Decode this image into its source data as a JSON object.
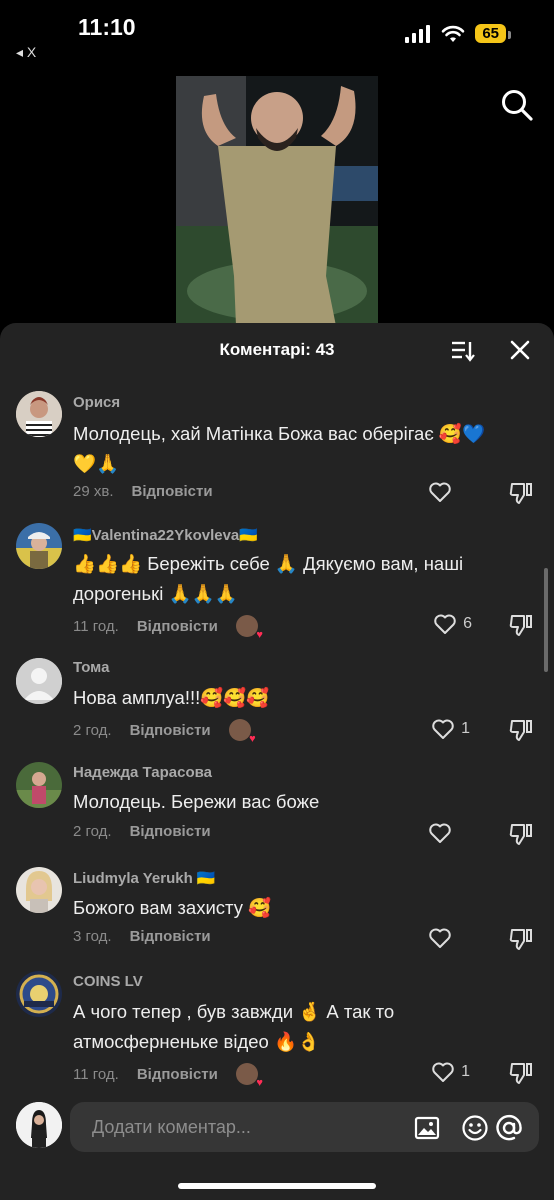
{
  "status": {
    "time": "11:10",
    "back": "◂ X",
    "battery": "65"
  },
  "comments_header": {
    "title": "Коментарі: 43"
  },
  "comments": [
    {
      "name": "Орися",
      "lines": [
        "Молодець, хай Матінка Божа вас оберігає 🥰💙",
        "💛🙏"
      ],
      "time": "29 хв.",
      "reply": "Відповісти",
      "likes": ""
    },
    {
      "name": "🇺🇦Valentina22Ykovleva🇺🇦",
      "lines": [
        "👍👍👍 Бережіть себе 🙏 Дякуємо вам, наші",
        "дорогенькі 🙏🙏🙏"
      ],
      "time": "11 год.",
      "reply": "Відповісти",
      "likes": "6"
    },
    {
      "name": "Тома",
      "lines": [
        "Нова амплуа!!!🥰🥰🥰"
      ],
      "time": "2 год.",
      "reply": "Відповісти",
      "likes": "1"
    },
    {
      "name": "Надежда Тарасова",
      "lines": [
        "Молодець. Бережи вас боже"
      ],
      "time": "2 год.",
      "reply": "Відповісти",
      "likes": ""
    },
    {
      "name": "Liudmyla Yerukh 🇺🇦",
      "lines": [
        "Божого вам захисту 🥰"
      ],
      "time": "3 год.",
      "reply": "Відповісти",
      "likes": ""
    },
    {
      "name": "COINS LV",
      "lines": [
        "А чого тепер , був завжди 🤞 А так то",
        "атмосферненьке відео 🔥👌"
      ],
      "time": "11 год.",
      "reply": "Відповісти",
      "likes": "1"
    }
  ],
  "input": {
    "placeholder": "Додати коментар..."
  },
  "colors": {
    "sheet": "#232323",
    "input": "#363636",
    "battery": "#f5c518",
    "heart_badge": "#ff2d55"
  }
}
